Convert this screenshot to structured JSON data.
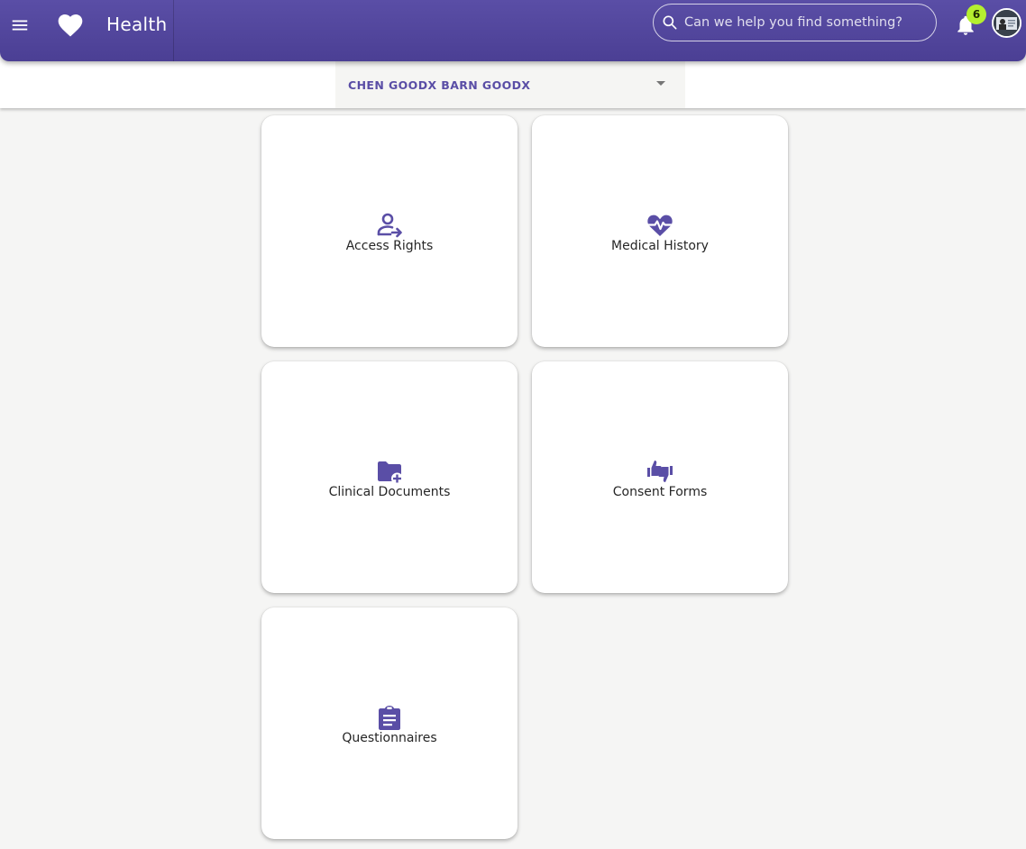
{
  "header": {
    "app_title": "Health",
    "search": {
      "placeholder": "Can we help you find something?",
      "value": ""
    },
    "notifications": {
      "count": "6"
    }
  },
  "patient_selector": {
    "selected": "CHEN GOODX BARN GOODX"
  },
  "tiles": [
    {
      "label": "Access Rights",
      "icon": "person-arrow-icon"
    },
    {
      "label": "Medical History",
      "icon": "heart-pulse-icon"
    },
    {
      "label": "Clinical Documents",
      "icon": "folder-plus-icon"
    },
    {
      "label": "Consent Forms",
      "icon": "thumbs-up-down-icon"
    },
    {
      "label": "Questionnaires",
      "icon": "clipboard-list-icon"
    }
  ],
  "colors": {
    "brand": "#5a4ea6",
    "badge": "#b5ef2f",
    "background": "#f5f5f4",
    "card": "#ffffff"
  }
}
